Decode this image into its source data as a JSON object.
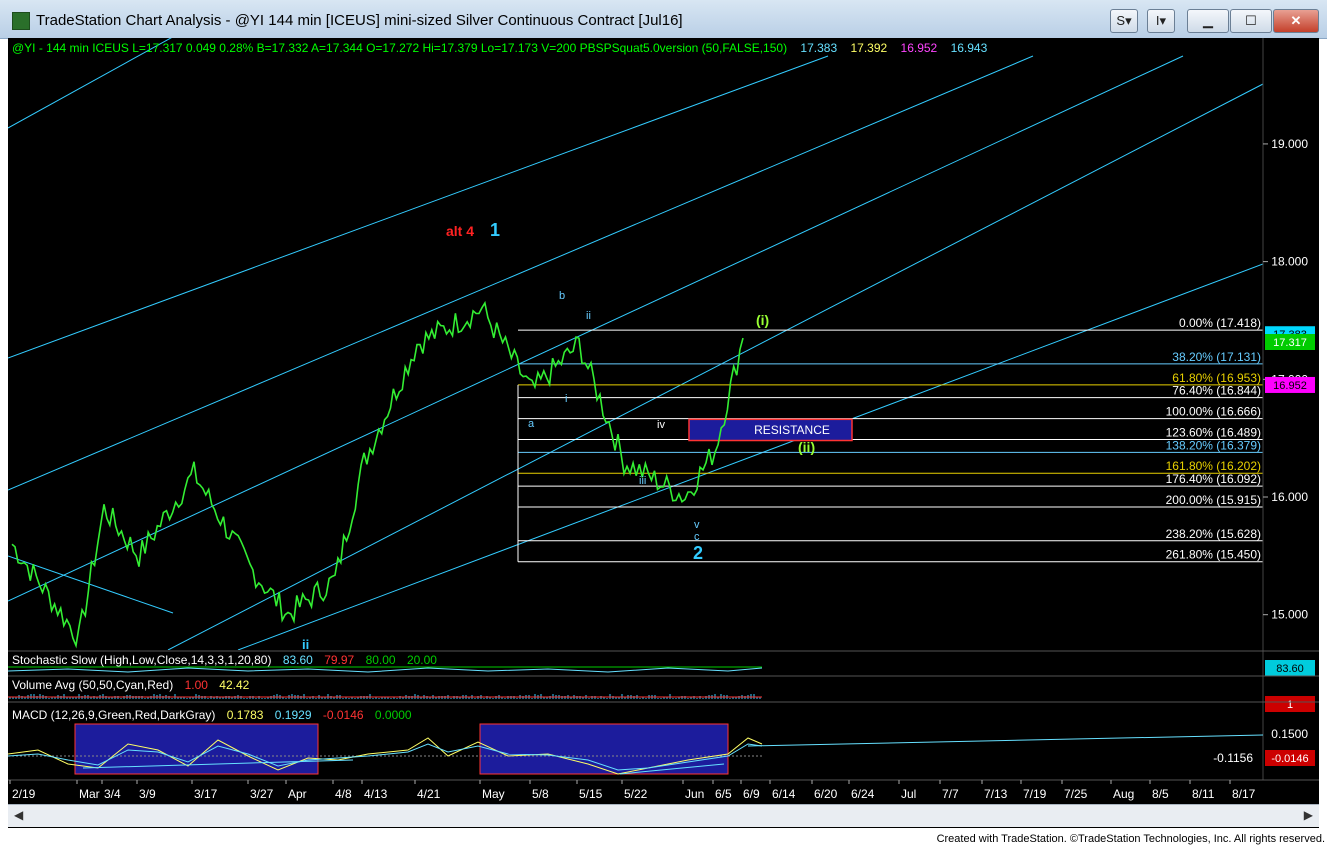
{
  "window": {
    "title": "TradeStation Chart Analysis - @YI 144 min [ICEUS] mini-sized Silver Continuous Contract [Jul16]",
    "buttons": [
      "S",
      "I"
    ]
  },
  "header": {
    "parts": [
      {
        "text": "@YI - 144 min  ICEUS  L=17.317  0.049   0.28%   B=17.332  A=17.344  O=17.272  Hi=17.379  Lo=17.173  V=200  PBSPSquat5.0version (50,FALSE,150)",
        "color": "#00ff00"
      },
      {
        "text": "17.383",
        "color": "#66e0ff"
      },
      {
        "text": "17.392",
        "color": "#ffff66"
      },
      {
        "text": "16.952",
        "color": "#ff44ff"
      },
      {
        "text": "16.943",
        "color": "#66e0ff"
      }
    ]
  },
  "chart_data": {
    "type": "line",
    "title": "@YI 144 min [ICEUS] mini-sized Silver Continuous Contract [Jul16]",
    "ylim": [
      14.7,
      19.9
    ],
    "y_ticks": [
      {
        "label": "19.000",
        "value": 19.0
      },
      {
        "label": "18.000",
        "value": 18.0
      },
      {
        "label": "17.000",
        "value": 17.0
      },
      {
        "label": "16.000",
        "value": 16.0
      },
      {
        "label": "15.000",
        "value": 15.0
      }
    ],
    "x_labels": [
      "2/19",
      "Mar",
      "3/4",
      "3/9",
      "3/17",
      "3/27",
      "Apr",
      "4/8",
      "4/13",
      "4/21",
      "May",
      "5/8",
      "5/15",
      "5/22",
      "Jun",
      "6/5",
      "6/9",
      "6/14",
      "6/20",
      "6/24",
      "Jul",
      "7/7",
      "7/13",
      "7/19",
      "7/25",
      "Aug",
      "8/5",
      "8/11",
      "8/17"
    ],
    "price_series": {
      "name": "@YI - 144 min",
      "x": [
        "2/19",
        "Mar",
        "3/4",
        "3/9",
        "3/17",
        "3/27",
        "Apr",
        "4/8",
        "4/13",
        "4/21",
        "May",
        "5/8",
        "5/15",
        "5/22",
        "Jun",
        "6/5",
        "6/9"
      ],
      "values": [
        15.6,
        14.8,
        15.9,
        15.5,
        16.2,
        15.4,
        15.0,
        15.3,
        16.3,
        17.3,
        17.6,
        16.9,
        17.3,
        16.3,
        16.0,
        16.4,
        17.35
      ]
    },
    "fibonacci": [
      {
        "label": "0.00% (17.418)",
        "value": 17.418,
        "color": "#ffffff"
      },
      {
        "label": "38.20% (17.131)",
        "value": 17.131,
        "color": "#66ccff"
      },
      {
        "label": "61.80% (16.953)",
        "value": 16.953,
        "color": "#e8d000"
      },
      {
        "label": "76.40% (16.844)",
        "value": 16.844,
        "color": "#ffffff"
      },
      {
        "label": "100.00% (16.666)",
        "value": 16.666,
        "color": "#ffffff"
      },
      {
        "label": "123.60% (16.489)",
        "value": 16.489,
        "color": "#ffffff"
      },
      {
        "label": "138.20% (16.379)",
        "value": 16.379,
        "color": "#66ccff"
      },
      {
        "label": "161.80% (16.202)",
        "value": 16.202,
        "color": "#e8d000"
      },
      {
        "label": "176.40% (16.092)",
        "value": 16.092,
        "color": "#ffffff"
      },
      {
        "label": "200.00% (15.915)",
        "value": 15.915,
        "color": "#ffffff"
      },
      {
        "label": "238.20% (15.628)",
        "value": 15.628,
        "color": "#ffffff"
      },
      {
        "label": "261.80% (15.450)",
        "value": 15.45,
        "color": "#ffffff"
      }
    ],
    "resistance_box": {
      "label": "RESISTANCE",
      "from": 16.48,
      "to": 16.66
    },
    "wave_labels": [
      {
        "text": "alt 4",
        "color": "#ff2222"
      },
      {
        "text": "1",
        "color": "#33ccff"
      },
      {
        "text": "2",
        "color": "#33ccff"
      },
      {
        "text": "(i)",
        "color": "#99ff33"
      },
      {
        "text": "(ii)",
        "color": "#99ff33"
      },
      {
        "text": "ii",
        "color": "#33ccff"
      },
      {
        "text": "a",
        "color": "#66ccff"
      },
      {
        "text": "b",
        "color": "#66ccff"
      },
      {
        "text": "c",
        "color": "#66ccff"
      },
      {
        "text": "i",
        "color": "#66ccff"
      },
      {
        "text": "ii",
        "color": "#66ccff"
      },
      {
        "text": "iii",
        "color": "#66ccff"
      },
      {
        "text": "iv",
        "color": "#ffffff"
      },
      {
        "text": "v",
        "color": "#66ccff"
      }
    ],
    "last_price_tags": [
      {
        "label": "17.383",
        "color": "#00d8ff"
      },
      {
        "label": "17.317",
        "color": "#00cc00"
      },
      {
        "label": "16.952",
        "color": "#ff00ff"
      }
    ]
  },
  "indicators": {
    "stochastic": {
      "parts": [
        {
          "text": "Stochastic Slow (High,Low,Close,14,3,3,1,20,80)",
          "color": "#ffffff"
        },
        {
          "text": "83.60",
          "color": "#66e0ff"
        },
        {
          "text": "79.97",
          "color": "#ff3333"
        },
        {
          "text": "80.00",
          "color": "#00cc00"
        },
        {
          "text": "20.00",
          "color": "#00cc00"
        }
      ],
      "tag": "83.60"
    },
    "volume": {
      "parts": [
        {
          "text": "Volume Avg (50,50,Cyan,Red)",
          "color": "#ffffff"
        },
        {
          "text": "1.00",
          "color": "#ff3333"
        },
        {
          "text": "42.42",
          "color": "#ffff66"
        }
      ],
      "tag": "1"
    },
    "macd": {
      "parts": [
        {
          "text": "MACD (12,26,9,Green,Red,DarkGray)",
          "color": "#ffffff"
        },
        {
          "text": "0.1783",
          "color": "#ffff66"
        },
        {
          "text": "0.1929",
          "color": "#66e0ff"
        },
        {
          "text": "-0.0146",
          "color": "#ff3333"
        },
        {
          "text": "0.0000",
          "color": "#00cc00"
        }
      ],
      "axis_label": "0.1500",
      "tag": "-0.0146",
      "annotation": "-0.1156"
    }
  },
  "footer": "Created with TradeStation. ©TradeStation Technologies, Inc. All rights reserved."
}
